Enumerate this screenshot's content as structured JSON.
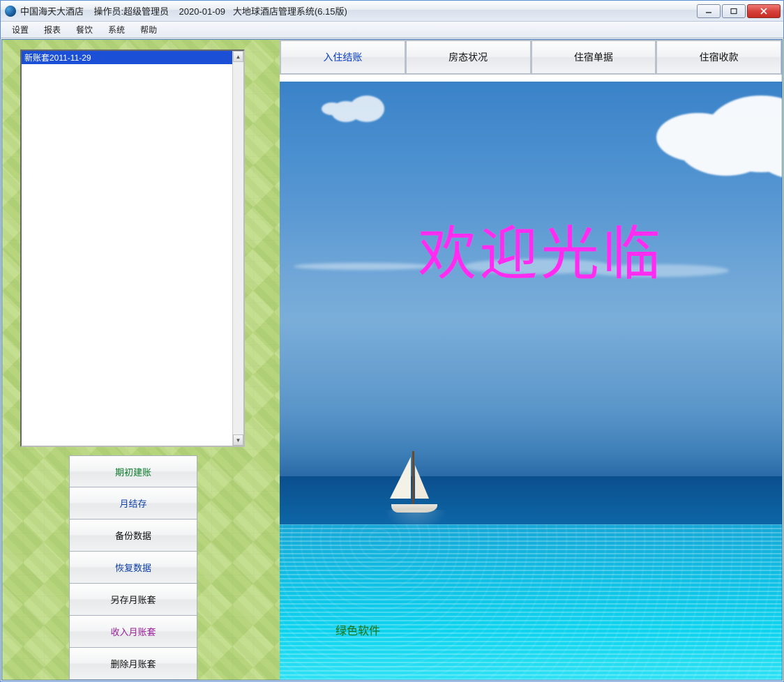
{
  "window": {
    "title": "中国海天大酒店    操作员:超级管理员    2020-01-09   大地球酒店管理系统(6.15版)"
  },
  "menu": {
    "items": [
      "设置",
      "报表",
      "餐饮",
      "系统",
      "帮助"
    ]
  },
  "sidebar": {
    "list_items": [
      "新账套2011-11-29"
    ],
    "selected_index": 0,
    "buttons": [
      {
        "label": "期初建账",
        "color": "c-green"
      },
      {
        "label": "月结存",
        "color": "c-blue"
      },
      {
        "label": "备份数据",
        "color": "c-black"
      },
      {
        "label": "恢复数据",
        "color": "c-blue"
      },
      {
        "label": "另存月账套",
        "color": "c-black"
      },
      {
        "label": "收入月账套",
        "color": "c-purple"
      },
      {
        "label": "删除月账套",
        "color": "c-black"
      }
    ]
  },
  "main": {
    "tabs": [
      "入住结账",
      "房态状况",
      "住宿单据",
      "住宿收款"
    ],
    "active_tab_index": 0,
    "welcome_text": "欢迎光临",
    "watermark": "绿色软件"
  }
}
